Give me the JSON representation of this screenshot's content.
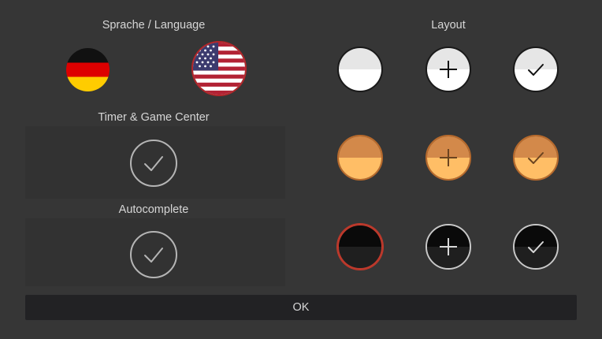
{
  "language": {
    "label": "Sprache / Language",
    "options": [
      {
        "name": "German",
        "icon": "german-flag-icon"
      },
      {
        "name": "English (US)",
        "icon": "us-flag-icon",
        "selected": true
      }
    ]
  },
  "timer": {
    "label": "Timer & Game Center",
    "checked": true,
    "icon": "checkmark-icon"
  },
  "autocomplete": {
    "label": "Autocomplete",
    "checked": true,
    "icon": "checkmark-icon"
  },
  "layout": {
    "label": "Layout",
    "themes": [
      {
        "name": "white",
        "colors": {
          "top": "#e6e6e6",
          "bottom": "#ffffff",
          "border": "#1a1a1a",
          "glyph": "#111111"
        }
      },
      {
        "name": "orange",
        "colors": {
          "top": "#d3894a",
          "bottom": "#ffbe66",
          "border": "#b86a2c",
          "glyph": "#6b4420"
        }
      },
      {
        "name": "black",
        "colors": {
          "top": "#0a0a0a",
          "bottom": "#1f1f1f",
          "border": "#c8c8c8",
          "selected_border": "#c0392b",
          "glyph": "#d8d8d8"
        }
      }
    ],
    "variants": [
      {
        "name": "plain",
        "icon": null
      },
      {
        "name": "plus",
        "icon": "plus-icon"
      },
      {
        "name": "check",
        "icon": "checkmark-icon"
      }
    ],
    "selected": {
      "theme": "black",
      "variant": "plain"
    }
  },
  "ok": {
    "label": "OK"
  },
  "colors": {
    "background": "#363636",
    "text": "#d6d6d6",
    "toggle_border": "#b5b5b5",
    "selected": "#c0392b"
  }
}
